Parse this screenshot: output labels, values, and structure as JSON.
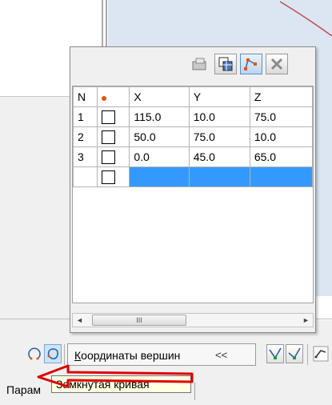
{
  "panel": {
    "toolbar": [
      "open-folder-icon",
      "copy-table-icon",
      "vertex-points-icon",
      "delete-icon"
    ],
    "columns": [
      "N",
      "",
      "X",
      "Y",
      "Z"
    ],
    "rows": [
      {
        "n": "1",
        "x": "115.0",
        "y": "10.0",
        "z": "75.0"
      },
      {
        "n": "2",
        "x": "50.0",
        "y": "75.0",
        "z": "10.0"
      },
      {
        "n": "3",
        "x": "0.0",
        "y": "45.0",
        "z": "65.0"
      },
      {
        "n": "",
        "x": "",
        "y": "",
        "z": ""
      }
    ],
    "scroll_arrow_left": "◄",
    "scroll_arrow_right": "►",
    "scroll_thumb_grip": "III"
  },
  "bottom_bar": {
    "coord_label_underlined": "К",
    "coord_label_rest": "оординаты вершин",
    "collapse_arrows": "<<"
  },
  "status": {
    "tab_label": "Парам",
    "tooltip": "Замкнутая кривая"
  },
  "colors": {
    "selection": "#3399ff",
    "accent_dot": "#e8530a",
    "annotation_arrow": "#e00000"
  }
}
